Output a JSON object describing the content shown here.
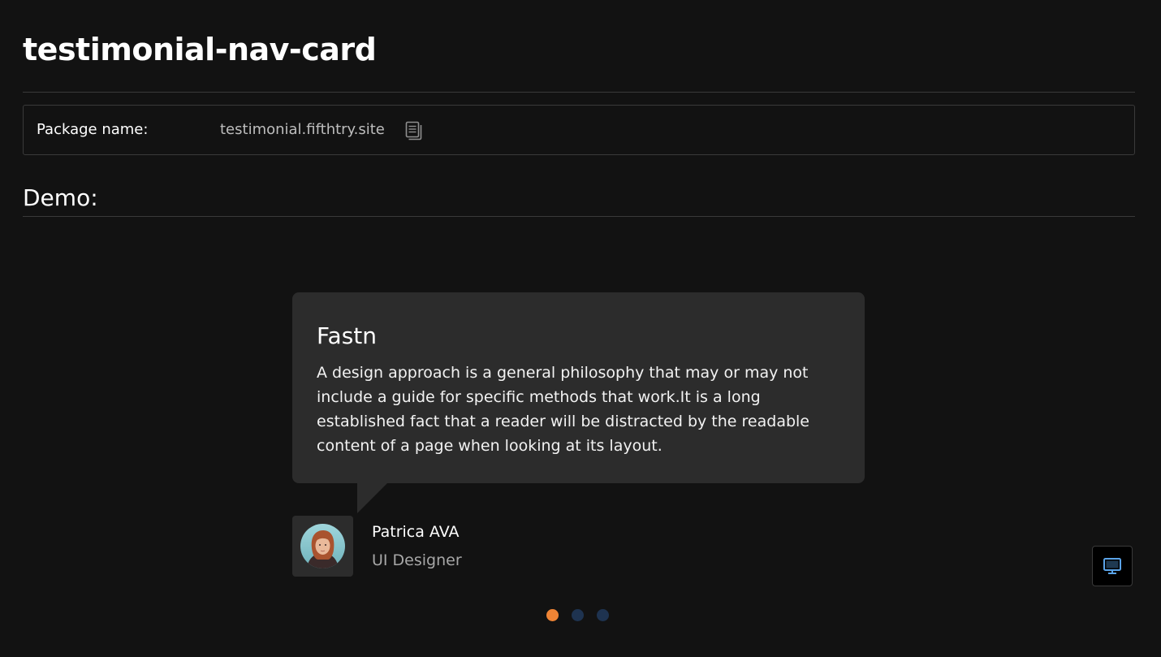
{
  "page": {
    "title": "testimonial-nav-card"
  },
  "package": {
    "label": "Package name:",
    "value": "testimonial.fifthtry.site",
    "copy_icon": "copy-icon"
  },
  "demo": {
    "heading": "Demo:"
  },
  "testimonial": {
    "title": "Fastn",
    "body": "A design approach is a general philosophy that may or may not include a guide for specific methods that work.It is a long established fact that a reader will be distracted by the readable content of a page when looking at its layout.",
    "author_name": "Patrica AVA",
    "author_role": "UI Designer",
    "avatar_icon": "avatar-photo"
  },
  "pagination": {
    "total": 3,
    "active_index": 0
  },
  "device_toggle": {
    "icon": "desktop-monitor-icon"
  },
  "colors": {
    "background": "#121212",
    "card": "#2c2c2c",
    "dot_active": "#ef8435",
    "dot_inactive": "#1e3350",
    "device_icon": "#5aa3e8"
  }
}
